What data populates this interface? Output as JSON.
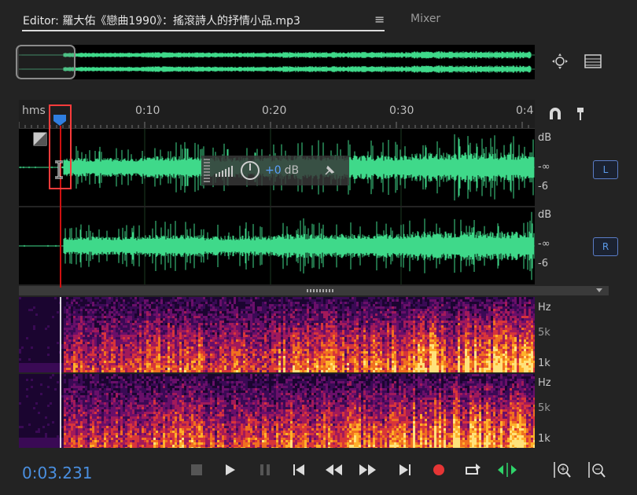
{
  "tabs": {
    "editor_label": "Editor: 羅大佑《戀曲1990》：搖滾詩人的抒情小品.mp3",
    "menu_icon": "≡",
    "mixer_label": "Mixer"
  },
  "ruler": {
    "unit": "hms",
    "labels": [
      "0:10",
      "0:20",
      "0:30",
      "0:4"
    ]
  },
  "channels": [
    {
      "badge": "L",
      "db_top": "dB",
      "db_mid": "-∞",
      "db_bottom": "-6"
    },
    {
      "badge": "R",
      "db_top": "dB",
      "db_mid": "-∞",
      "db_bottom": "-6"
    }
  ],
  "spectral": [
    {
      "hz": "Hz",
      "mid": "5k",
      "low": "1k"
    },
    {
      "hz": "Hz",
      "mid": "5k",
      "low": "1k"
    }
  ],
  "hud": {
    "value": "+0",
    "unit": "dB"
  },
  "transport": {
    "timecode": "0:03.231"
  },
  "colors": {
    "waveform": "#3fd98a",
    "accent": "#4a8fe0",
    "record": "#e53535",
    "highlight": "#ff3b3b"
  }
}
